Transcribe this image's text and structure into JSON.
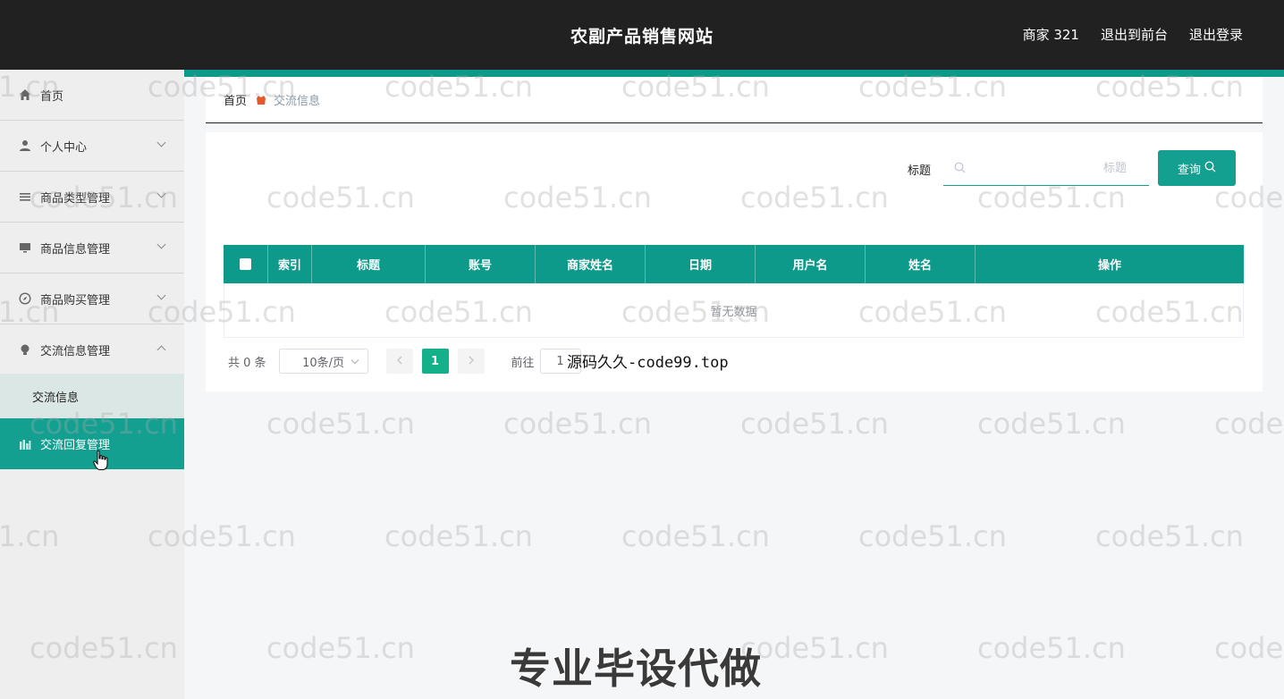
{
  "header": {
    "title": "农副产品销售网站",
    "user": "商家 321",
    "exit_front": "退出到前台",
    "logout": "退出登录"
  },
  "sidebar": {
    "items": [
      {
        "label": "首页",
        "icon": "home-icon"
      },
      {
        "label": "个人中心",
        "icon": "user-icon"
      },
      {
        "label": "商品类型管理",
        "icon": "list-icon"
      },
      {
        "label": "商品信息管理",
        "icon": "monitor-icon"
      },
      {
        "label": "商品购买管理",
        "icon": "compass-icon"
      },
      {
        "label": "交流信息管理",
        "icon": "bulb-icon"
      }
    ],
    "sub_item": "交流信息",
    "active_item": "交流回复管理"
  },
  "breadcrumb": {
    "home": "首页",
    "current": "交流信息"
  },
  "search": {
    "label": "标题",
    "placeholder": "标题",
    "button": "查询"
  },
  "table": {
    "columns": [
      "索引",
      "标题",
      "账号",
      "商家姓名",
      "日期",
      "用户名",
      "姓名",
      "操作"
    ],
    "empty_text": "暂无数据"
  },
  "pagination": {
    "total": "共 0 条",
    "page_size": "10条/页",
    "current_page": "1",
    "goto_label": "前往",
    "goto_value": "1"
  },
  "overlays": {
    "code99": "源码久久-code99.top",
    "promo": "专业毕设代做",
    "watermark": "code51.cn",
    "watermark_partial_left": "1.cn",
    "watermark_partial_right": "code"
  },
  "colors": {
    "accent": "#13a091",
    "topbar": "#212121",
    "sidebar": "#eeeeee"
  }
}
